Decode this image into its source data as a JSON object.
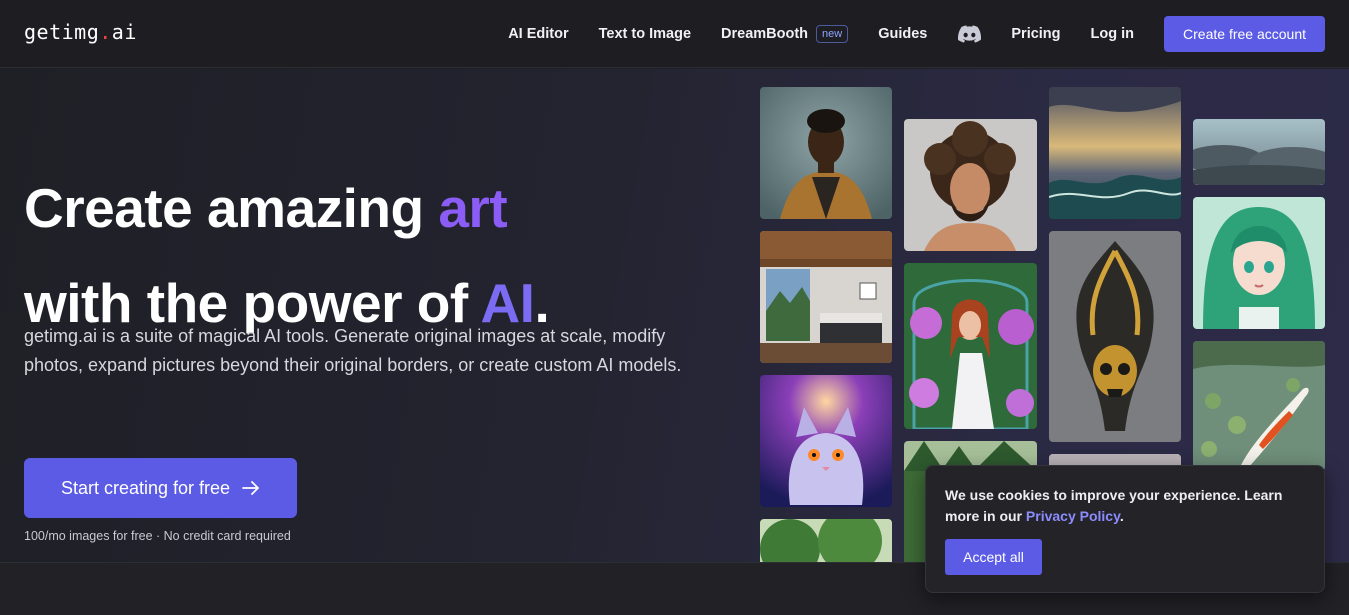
{
  "nav": {
    "logo_main": "getimg",
    "logo_dot": ".",
    "logo_suffix": "ai",
    "links": [
      {
        "label": "AI Editor"
      },
      {
        "label": "Text to Image"
      },
      {
        "label": "DreamBooth",
        "badge": "new"
      },
      {
        "label": "Guides"
      },
      {
        "label": "Pricing"
      },
      {
        "label": "Log in"
      }
    ],
    "discord_icon": "discord-icon",
    "cta": "Create free account"
  },
  "hero": {
    "line1_a": "Create amazing ",
    "line1_b": "art",
    "line2_a": "with the power of ",
    "line2_b": "AI",
    "line2_c": ".",
    "description": "getimg.ai is a suite of magical AI tools. Generate original images at scale, modify photos, expand pictures beyond their original borders, or create custom AI models.",
    "cta": "Start creating for free",
    "cta_icon": "arrow-right-icon",
    "note": "100/mo images for free · No credit card required"
  },
  "colors": {
    "accent": "#5b5be6",
    "headline_highlight": "#8b5cf6",
    "link": "#8c8cff"
  },
  "cookie": {
    "text_before": "We use cookies to improve your experience. Learn more in our ",
    "link": "Privacy Policy",
    "text_after": ".",
    "accept": "Accept all"
  }
}
